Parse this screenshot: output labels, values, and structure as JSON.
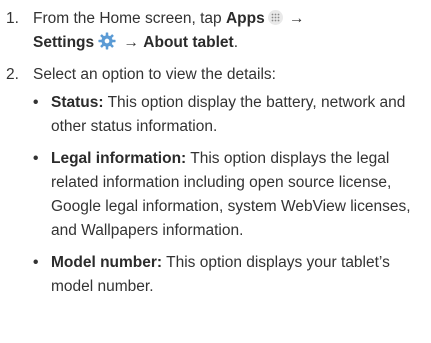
{
  "steps": [
    {
      "number": "1.",
      "line1_prefix": "From the Home screen, tap ",
      "apps_label": "Apps",
      "arrow1": " → ",
      "settings_label": "Settings",
      "arrow2": " → ",
      "about_label": "About tablet",
      "period": "."
    },
    {
      "number": "2.",
      "text": "Select an option to view the details:"
    }
  ],
  "options": [
    {
      "term": "Status:",
      "desc": " This option display the battery, network and other status information."
    },
    {
      "term": "Legal information:",
      "desc": " This option displays the legal related information including open source license, Google legal information, system WebView licenses, and Wallpapers information."
    },
    {
      "term": "Model number:",
      "desc": " This option displays your tablet’s model number."
    }
  ],
  "icons": {
    "apps": "apps-grid-icon",
    "settings": "settings-gear-icon",
    "gear_color": "#5b9bd5"
  }
}
